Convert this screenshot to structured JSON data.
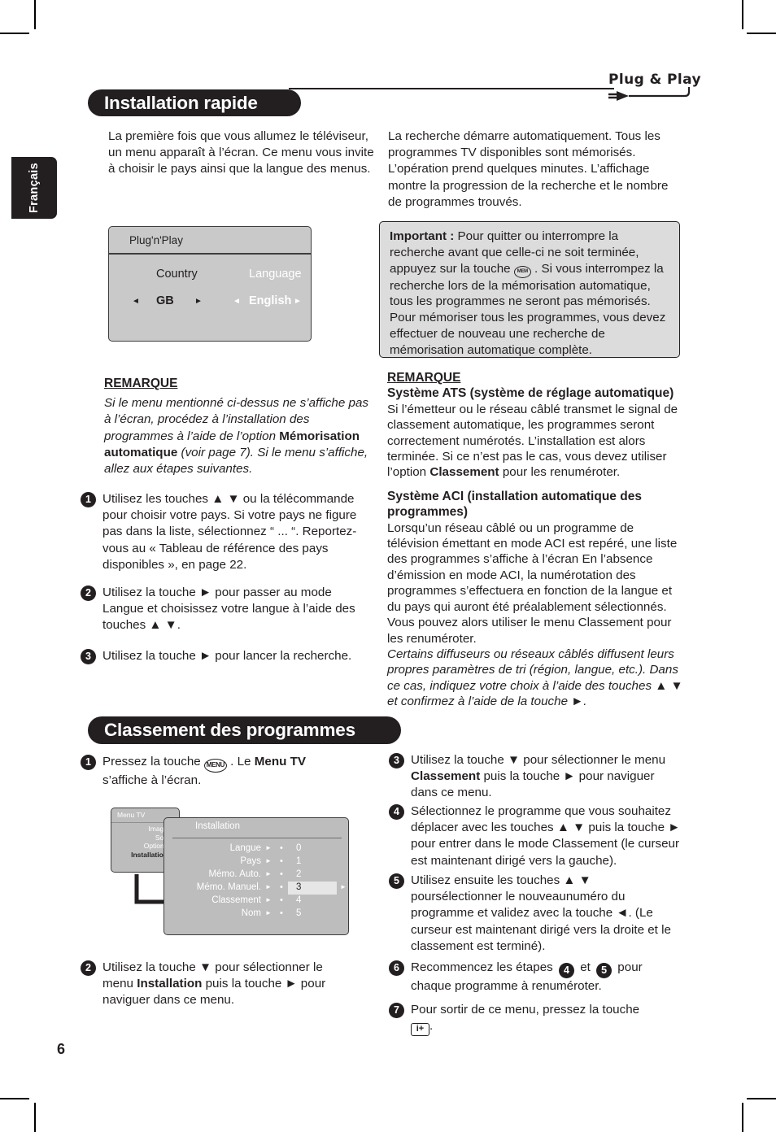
{
  "page": {
    "number": "6",
    "language_tab": "Français"
  },
  "header": {
    "logo_text": "Plug & Play",
    "logo_icon": "power-plug-icon"
  },
  "sections": [
    {
      "id": "installation",
      "title": "Installation rapide"
    },
    {
      "id": "classement",
      "title": "Classement des programmes"
    }
  ],
  "intro": {
    "left": "La première fois que vous allumez le téléviseur, un menu apparaît à l’écran. Ce menu vous invite à choisir le pays ainsi que la langue des menus.",
    "right": "La recherche démarre automatiquement. Tous les programmes TV disponibles sont mémorisés. L’opération prend quelques minutes. L’affichage montre la progression de la recherche et le nombre de programmes trouvés."
  },
  "plug_n_play_screen": {
    "title": "Plug'n'Play",
    "country_label": "Country",
    "country_value": "GB",
    "language_label": "Language",
    "language_value": "English",
    "left_arrow": "◄",
    "right_arrow": "►"
  },
  "important_box": {
    "label": "Important :",
    "text_before_key": " Pour quitter ou interrompre la recherche avant que celle-ci ne soit terminée, appuyez sur la touche ",
    "key": "MEM",
    "text_after_key": " . Si vous interrompez la recherche lors de la mémorisation automatique, tous les programmes ne seront pas mémorisés. Pour mémoriser tous les programmes, vous devez effectuer de nouveau une recherche de mémorisation automatique complète."
  },
  "remarque_left": {
    "heading": "REMARQUE",
    "part1": "Si le menu mentionné ci-dessus ne s’affiche pas à l’écran, procédez à l’installation des programmes à l’aide de l’option ",
    "bold": "Mémorisation automatique",
    "part2": " (voir page 7). Si le menu s’affiche, allez aux étapes suivantes."
  },
  "steps_installation": [
    {
      "num": "1",
      "text": "Utilisez les touches ▲ ▼ ou la télécommande pour choisir votre pays. Si votre pays ne figure pas dans la liste, sélectionnez “ ... “. Reportez-vous au « Tableau de référence des pays disponibles », en page 22."
    },
    {
      "num": "2",
      "text": "Utilisez la touche ► pour passer au mode Langue et choisissez votre langue à l’aide des touches ▲ ▼."
    },
    {
      "num": "3",
      "text": "Utilisez la touche ► pour lancer la recherche."
    }
  ],
  "remarque_right": {
    "heading": "REMARQUE",
    "ats_heading": "Système ATS (système de réglage automatique)",
    "ats_part1": "Si l’émetteur ou le réseau câblé transmet le signal de classement automatique, les programmes seront correctement numérotés. L’installation est alors terminée. Si ce n’est pas le cas, vous devez utiliser l’option ",
    "ats_bold": "Classement",
    "ats_part2": " pour les renuméroter.",
    "aci_heading": "Système ACI (installation automatique des programmes)",
    "aci_text": "Lorsqu’un réseau câblé ou un programme de télévision émettant en mode ACI est repéré, une liste des programmes s’affiche à l’écran En l’absence d’émission en mode ACI, la numérotation des programmes s’effectuera en fonction de la langue et du pays qui auront été préalablement sélectionnés. Vous pouvez alors utiliser le menu Classement pour les renuméroter.",
    "aci_italic": "Certains diffuseurs ou réseaux câblés diffusent leurs propres paramètres de tri (région, langue, etc.). Dans ce cas, indiquez votre choix à l’aide des touches ▲ ▼ et confirmez à l’aide de la touche ►."
  },
  "steps_classement_left": [
    {
      "num": "1",
      "before_key": "Pressez la touche ",
      "key": "MENU",
      "after_key_plain": " . Le ",
      "after_key_bold": "Menu TV",
      "tail": " s’affiche à l’écran."
    },
    {
      "num": "2",
      "part1": "Utilisez la touche ▼ pour sélectionner le menu ",
      "bold": "Installation",
      "part2": " puis la touche ► pour naviguer dans ce menu."
    }
  ],
  "steps_classement_right": [
    {
      "num": "3",
      "part1": "Utilisez la touche ▼ pour sélectionner le menu ",
      "bold": "Classement",
      "part2": " puis la touche ► pour naviguer dans ce menu."
    },
    {
      "num": "4",
      "text": "Sélectionnez le programme que vous souhaitez déplacer avec les touches ▲ ▼ puis la touche ► pour entrer dans le mode Classement (le curseur est maintenant dirigé vers la gauche)."
    },
    {
      "num": "5",
      "text": "Utilisez ensuite les touches ▲ ▼ poursélectionner le nouveaunuméro du programme et validez avec la touche ◄. (Le curseur est maintenant dirigé vers la droite et le classement est terminé)."
    },
    {
      "num": "6",
      "part1": "Recommencez les étapes ",
      "ref1": "4",
      "mid": " et ",
      "ref2": "5",
      "part2": " pour chaque programme à renuméroter."
    },
    {
      "num": "7",
      "part1": "Pour sortir de ce menu, pressez la touche ",
      "key": "i+",
      "part2": "."
    }
  ],
  "tv_menu_diagram": {
    "menu_tv_title": "Menu TV",
    "menu_tv_items": [
      {
        "label": "Image",
        "selected": false
      },
      {
        "label": "Son",
        "selected": false
      },
      {
        "label": "Options",
        "selected": false
      },
      {
        "label": "Installation",
        "selected": true
      }
    ],
    "installation_title": "Installation",
    "installation_rows": [
      {
        "label": "Langue",
        "arrow": "►",
        "dot": "•",
        "num": "0",
        "highlight": false
      },
      {
        "label": "Pays",
        "arrow": "►",
        "dot": "•",
        "num": "1",
        "highlight": false
      },
      {
        "label": "Mémo. Auto.",
        "arrow": "►",
        "dot": "•",
        "num": "2",
        "highlight": false
      },
      {
        "label": "Mémo. Manuel.",
        "arrow": "►",
        "dot": "•",
        "num": "3",
        "highlight": true,
        "end_arrow": "►"
      },
      {
        "label": "Classement",
        "arrow": "►",
        "dot": "•",
        "num": "4",
        "highlight": false
      },
      {
        "label": "Nom",
        "arrow": "►",
        "dot": "•",
        "num": "5",
        "highlight": false
      }
    ]
  },
  "colors": {
    "ink": "#231f20",
    "screen_gray": "#c9c9c9",
    "menu_gray": "#bdbdbd",
    "box_gray": "#dcdcdc"
  }
}
